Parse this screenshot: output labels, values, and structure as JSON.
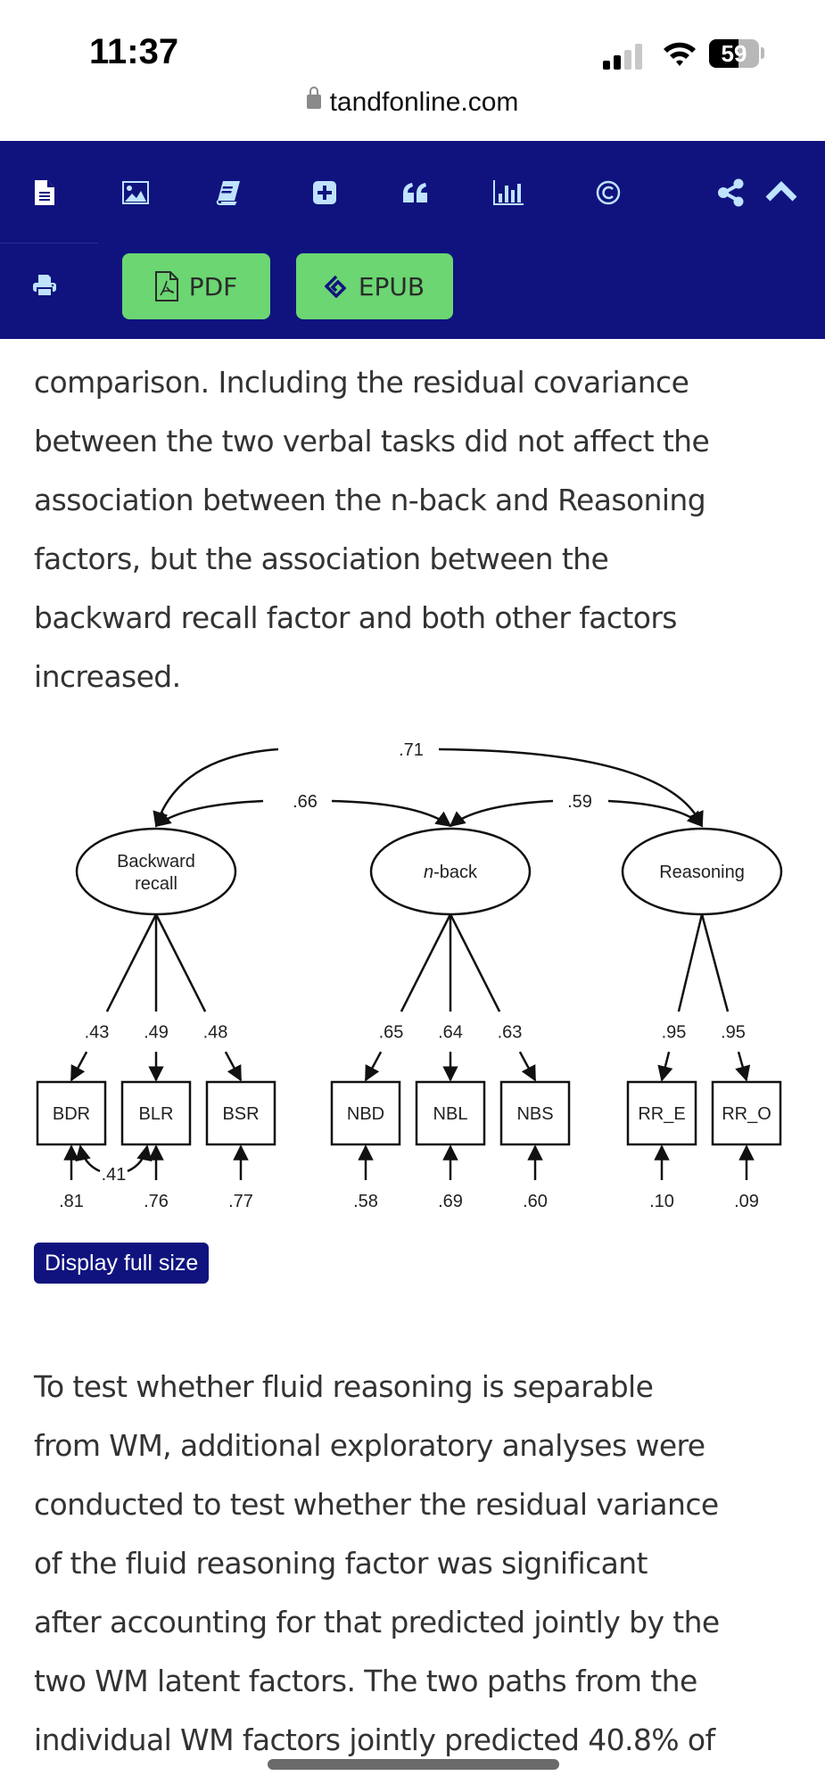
{
  "status_bar": {
    "time": "11:37",
    "battery_percent": "59",
    "battery_level": 0.59,
    "signal_bars_active": 2,
    "signal_bars_total": 4
  },
  "browser": {
    "url": "tandfonline.com"
  },
  "toolbar": {
    "icons": [
      {
        "name": "full-text-icon",
        "label": "Full text"
      },
      {
        "name": "figures-icon",
        "label": "Figures"
      },
      {
        "name": "references-icon",
        "label": "References"
      },
      {
        "name": "supplemental-icon",
        "label": "Supplemental"
      },
      {
        "name": "citation-icon",
        "label": "Citation"
      },
      {
        "name": "metrics-icon",
        "label": "Metrics"
      },
      {
        "name": "licensing-icon",
        "label": "Licensing"
      }
    ],
    "pdf_label": "PDF",
    "epub_label": "EPUB",
    "colors": {
      "bar": "#10137e",
      "icon": "#bfe3ff",
      "button": "#6bd672"
    }
  },
  "article": {
    "paragraph1_lines": [
      "comparison. Including the residual covariance",
      "between the two verbal tasks did not affect the",
      "association between the n-back and Reasoning",
      "factors, but the association between the",
      "backward recall factor and both other factors",
      "increased."
    ],
    "paragraph2_lines": [
      "To test whether fluid reasoning is separable",
      "from WM, additional exploratory analyses were",
      "conducted to test whether the residual variance",
      "of the fluid reasoning factor was significant",
      "after accounting for that predicted jointly by the",
      "two WM latent factors. The two paths from the",
      "individual WM factors jointly predicted 40.8% of"
    ]
  },
  "figure": {
    "display_full_size_label": "Display full size",
    "latent_factors": [
      {
        "id": "br",
        "label_lines": [
          "Backward",
          "recall"
        ],
        "italic_prefix": ""
      },
      {
        "id": "nb",
        "label_lines": [
          "-back"
        ],
        "italic_prefix": "n"
      },
      {
        "id": "re",
        "label_lines": [
          "Reasoning"
        ],
        "italic_prefix": ""
      }
    ],
    "factor_correlations": [
      {
        "from": "br",
        "to": "re",
        "value": ".71"
      },
      {
        "from": "br",
        "to": "nb",
        "value": ".66"
      },
      {
        "from": "nb",
        "to": "re",
        "value": ".59"
      }
    ],
    "indicators": [
      {
        "label": "BDR",
        "factor": "br",
        "loading": ".43",
        "residual": ".81"
      },
      {
        "label": "BLR",
        "factor": "br",
        "loading": ".49",
        "residual": ".76"
      },
      {
        "label": "BSR",
        "factor": "br",
        "loading": ".48",
        "residual": ".77"
      },
      {
        "label": "NBD",
        "factor": "nb",
        "loading": ".65",
        "residual": ".58"
      },
      {
        "label": "NBL",
        "factor": "nb",
        "loading": ".64",
        "residual": ".69"
      },
      {
        "label": "NBS",
        "factor": "nb",
        "loading": ".63",
        "residual": ".60"
      },
      {
        "label": "RR_E",
        "factor": "re",
        "loading": ".95",
        "residual": ".10"
      },
      {
        "label": "RR_O",
        "factor": "re",
        "loading": ".95",
        "residual": ".09"
      }
    ],
    "residual_covariance": {
      "between": [
        "BDR",
        "BLR"
      ],
      "value": ".41"
    }
  }
}
